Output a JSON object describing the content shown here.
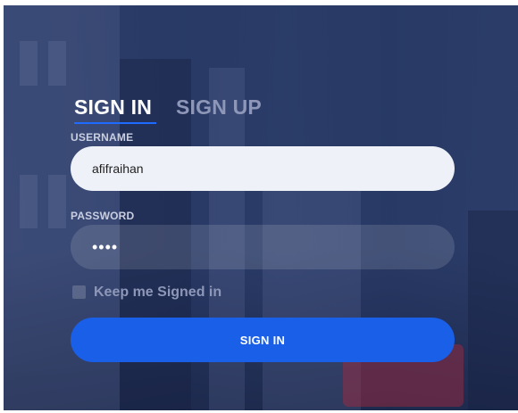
{
  "tabs": {
    "sign_in": "SIGN IN",
    "sign_up": "SIGN UP"
  },
  "username": {
    "label": "USERNAME",
    "value": "afifraihan"
  },
  "password": {
    "label": "PASSWORD",
    "value": "••••"
  },
  "remember": {
    "label": "Keep me Signed in",
    "checked": false
  },
  "submit": {
    "label": "SIGN IN"
  },
  "colors": {
    "accent": "#1a5fe8",
    "overlay": "#283965"
  }
}
